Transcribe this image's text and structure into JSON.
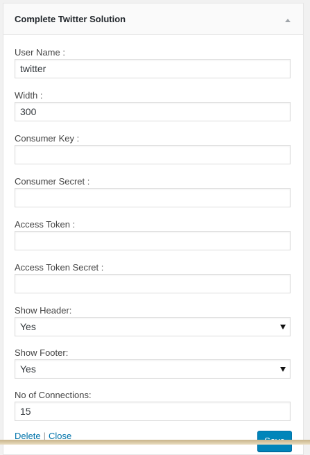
{
  "widget": {
    "title": "Complete Twitter Solution",
    "toggle_icon": "triangle-up-icon"
  },
  "fields": {
    "username": {
      "label": "User Name :",
      "value": "twitter"
    },
    "width": {
      "label": "Width :",
      "value": "300"
    },
    "consumer_key": {
      "label": "Consumer Key :",
      "value": ""
    },
    "consumer_secret": {
      "label": "Consumer Secret :",
      "value": ""
    },
    "access_token": {
      "label": "Access Token :",
      "value": ""
    },
    "access_token_secret": {
      "label": "Access Token Secret :",
      "value": ""
    },
    "show_header": {
      "label": "Show Header:",
      "value": "Yes"
    },
    "show_footer": {
      "label": "Show Footer:",
      "value": "Yes"
    },
    "connections": {
      "label": "No of Connections:",
      "value": "15"
    }
  },
  "footer": {
    "delete_label": "Delete",
    "separator": "|",
    "close_label": "Close",
    "save_label": "Save"
  },
  "colors": {
    "link": "#0073aa",
    "primary_button": "#0085ba"
  }
}
